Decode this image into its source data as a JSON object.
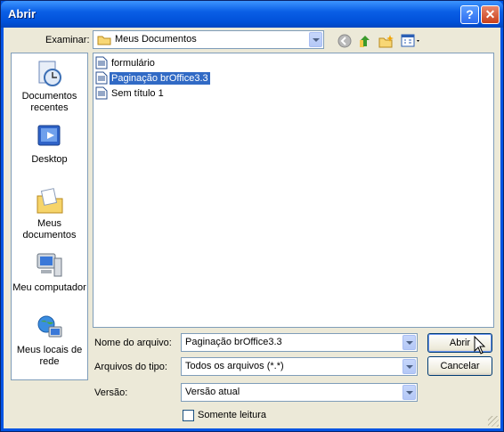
{
  "window": {
    "title": "Abrir"
  },
  "lookin": {
    "label": "Examinar:",
    "value": "Meus Documentos"
  },
  "places": [
    {
      "label": "Documentos recentes"
    },
    {
      "label": "Desktop"
    },
    {
      "label": "Meus documentos"
    },
    {
      "label": "Meu computador"
    },
    {
      "label": "Meus locais de rede"
    }
  ],
  "files": [
    {
      "name": "formulário",
      "selected": false
    },
    {
      "name": "Paginação brOffice3.3",
      "selected": true
    },
    {
      "name": "Sem título 1",
      "selected": false
    }
  ],
  "filename": {
    "label": "Nome do arquivo:",
    "value": "Paginação brOffice3.3"
  },
  "filetype": {
    "label": "Arquivos do tipo:",
    "value": "Todos os arquivos (*.*)"
  },
  "version": {
    "label": "Versão:",
    "value": "Versão atual"
  },
  "readonly": {
    "label": "Somente leitura",
    "checked": false
  },
  "buttons": {
    "open": "Abrir",
    "cancel": "Cancelar"
  },
  "colors": {
    "titlebar": "#0054e3",
    "selection": "#316ac5",
    "dialog_bg": "#ece9d8"
  }
}
